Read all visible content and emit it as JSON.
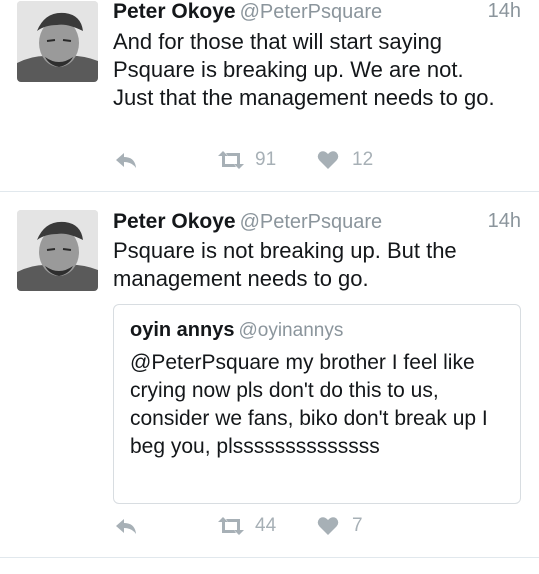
{
  "tweets": [
    {
      "author_name": "Peter Okoye",
      "author_handle": "@PeterPsquare",
      "time": "14h",
      "text": "And for those that will start saying Psquare is breaking up. We are not. Just that the management needs to go.",
      "retweets": "91",
      "likes": "12"
    },
    {
      "author_name": "Peter Okoye",
      "author_handle": "@PeterPsquare",
      "time": "14h",
      "text": "Psquare is not breaking up. But the management needs to go.",
      "quoted": {
        "author_name": "oyin annys",
        "author_handle": "@oyinannys",
        "text": "@PeterPsquare  my brother I feel like crying now pls don't do this to us, consider we fans, biko don't break up I beg you, plssssssssssssss"
      },
      "retweets": "44",
      "likes": "7"
    }
  ],
  "icons": {
    "avatar": "avatar-image",
    "reply": "reply-icon",
    "retweet": "retweet-icon",
    "like": "heart-icon"
  },
  "colors": {
    "secondary_text": "#8b959c",
    "action_icon": "#a7b0b6",
    "divider": "#e1e8ed"
  }
}
